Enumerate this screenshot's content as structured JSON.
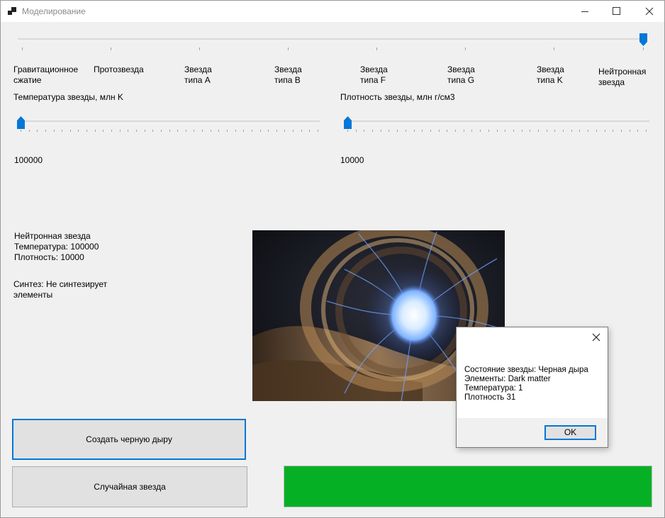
{
  "window": {
    "title": "Моделирование",
    "controls": [
      "minimize-icon",
      "maximize-icon",
      "close-icon"
    ]
  },
  "stage_slider": {
    "value_index": 7,
    "max_index": 7,
    "labels": [
      "Гравитационное\nсжатие",
      "Протозвезда",
      "Звезда\nтипа A",
      "Звезда\nтипа B",
      "Звезда\nтипа F",
      "Звезда\nтипа G",
      "Звезда\nтипа K",
      "Нейтронная\nзвезда"
    ]
  },
  "temperature": {
    "label": "Температура звезды, млн K",
    "value": "100000",
    "slider_fraction": 0.0
  },
  "density": {
    "label": "Плотность звезды, млн г/см3",
    "value": "10000",
    "slider_fraction": 0.0
  },
  "star_info": {
    "name": "Нейтронная звезда",
    "temperature_line": "Температура: 100000",
    "density_line": "Плотность: 10000",
    "synthesis": "Синтез: Не синтезирует\nэлементы"
  },
  "buttons": {
    "create_black_hole": "Создать черную дыру",
    "random_star": "Случайная звезда"
  },
  "progress": {
    "fraction": 1.0,
    "color": "#06b025"
  },
  "message_box": {
    "text": "Состояние звезды: Черная дыра\nЭлементы: Dark matter\nТемпература: 1\nПлотность 31",
    "ok_label": "OK"
  },
  "colors": {
    "accent": "#0078d7",
    "progress": "#06b025"
  }
}
